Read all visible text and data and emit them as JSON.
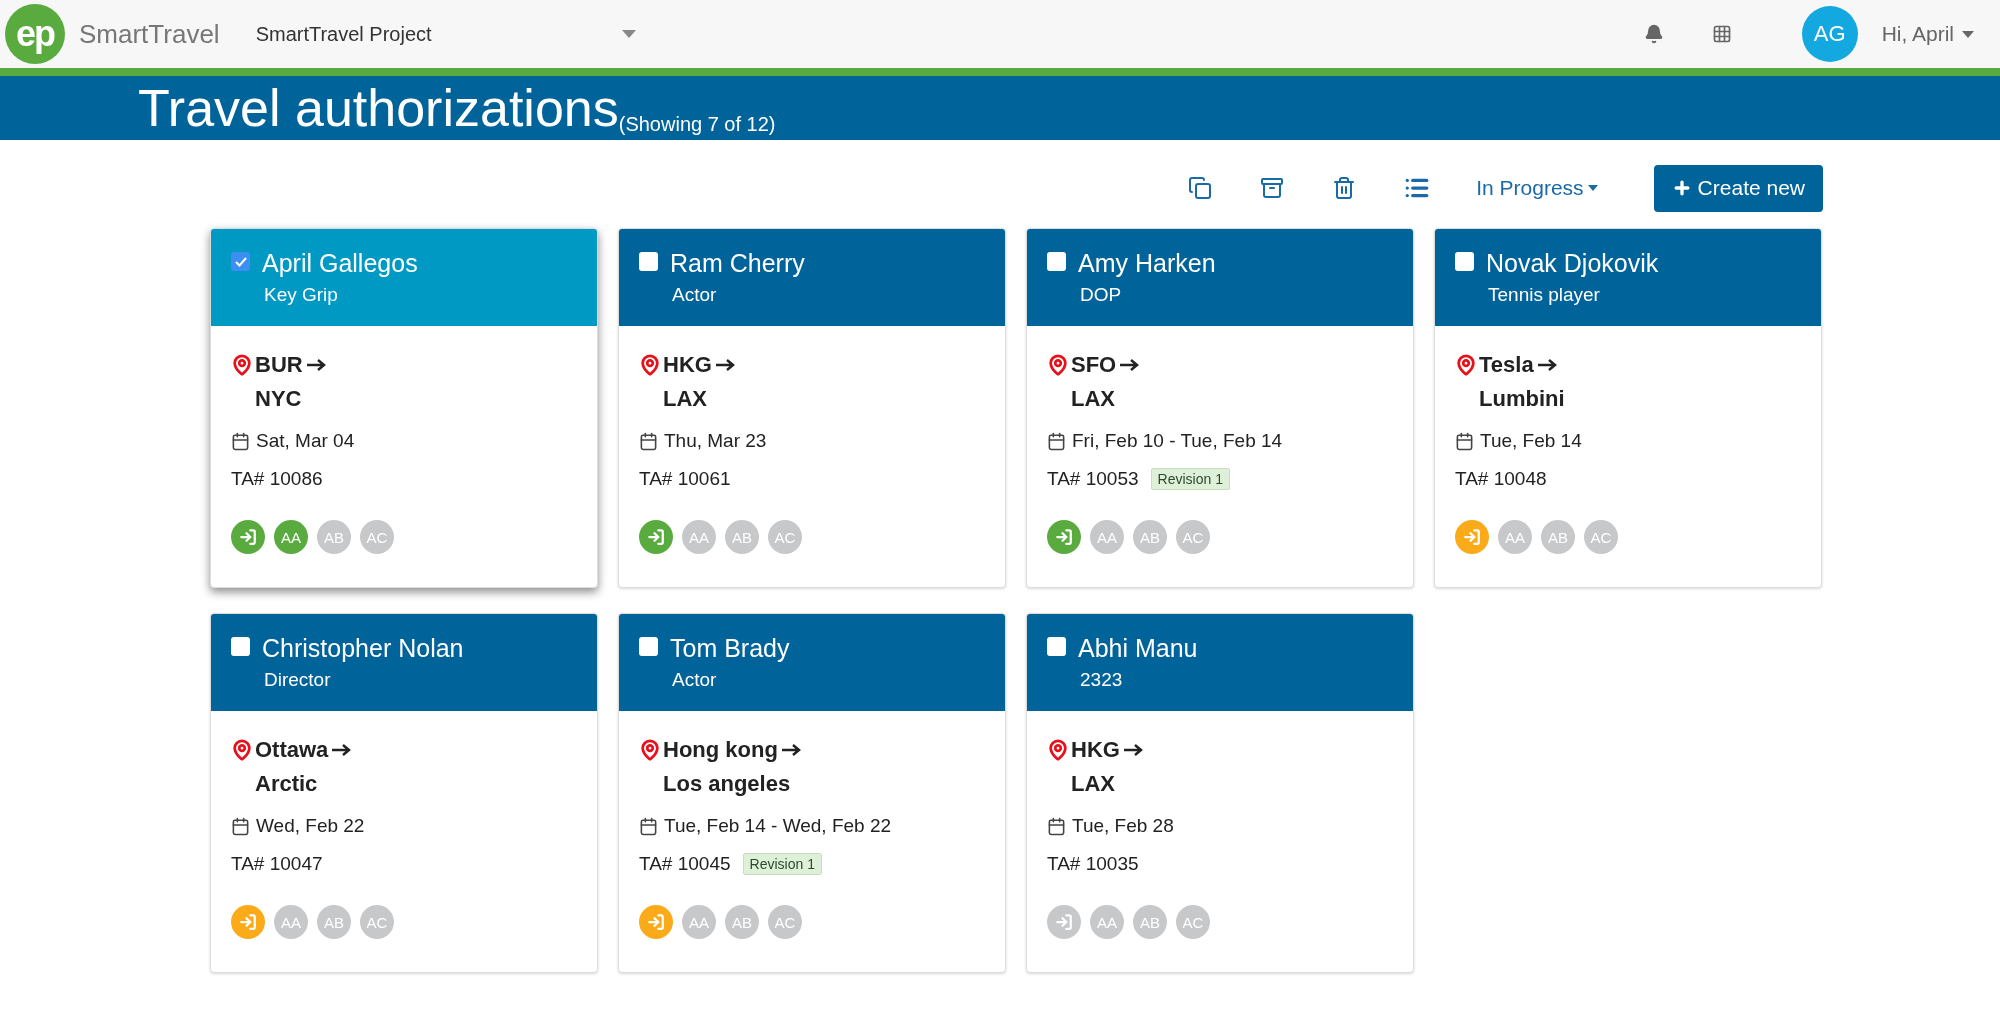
{
  "app": {
    "logo": "ep",
    "name": "SmartTravel",
    "project": "SmartTravel Project",
    "user_initials": "AG",
    "greeting": "Hi, April"
  },
  "page": {
    "title": "Travel authorizations",
    "count": "(Showing 7 of 12)"
  },
  "toolbar": {
    "filter": "In Progress",
    "create": "Create new"
  },
  "cards": [
    {
      "name": "April Gallegos",
      "role": "Key Grip",
      "selected": true,
      "from": "BUR",
      "to": "NYC",
      "dates": "Sat, Mar 04",
      "ta": "TA# 10086",
      "steps": [
        {
          "kind": "submit",
          "color": "#5aab3f"
        },
        {
          "kind": "approver",
          "label": "AA",
          "color": "#5aab3f"
        },
        {
          "kind": "approver",
          "label": "AB",
          "color": "#c6c8ca"
        },
        {
          "kind": "approver",
          "label": "AC",
          "color": "#c6c8ca"
        }
      ]
    },
    {
      "name": "Ram Cherry",
      "role": "Actor",
      "selected": false,
      "from": "HKG",
      "to": "LAX",
      "dates": "Thu, Mar 23",
      "ta": "TA# 10061",
      "steps": [
        {
          "kind": "submit",
          "color": "#5aab3f"
        },
        {
          "kind": "approver",
          "label": "AA",
          "color": "#c6c8ca"
        },
        {
          "kind": "approver",
          "label": "AB",
          "color": "#c6c8ca"
        },
        {
          "kind": "approver",
          "label": "AC",
          "color": "#c6c8ca"
        }
      ]
    },
    {
      "name": "Amy Harken",
      "role": "DOP",
      "selected": false,
      "from": "SFO",
      "to": "LAX",
      "dates": "Fri, Feb 10 - Tue, Feb 14",
      "ta": "TA# 10053",
      "badge": "Revision 1",
      "steps": [
        {
          "kind": "submit",
          "color": "#5aab3f"
        },
        {
          "kind": "approver",
          "label": "AA",
          "color": "#c6c8ca"
        },
        {
          "kind": "approver",
          "label": "AB",
          "color": "#c6c8ca"
        },
        {
          "kind": "approver",
          "label": "AC",
          "color": "#c6c8ca"
        }
      ]
    },
    {
      "name": "Novak Djokovik",
      "role": "Tennis player",
      "selected": false,
      "from": "Tesla",
      "to": "Lumbini",
      "dates": "Tue, Feb 14",
      "ta": "TA# 10048",
      "steps": [
        {
          "kind": "submit",
          "color": "#fbab19"
        },
        {
          "kind": "approver",
          "label": "AA",
          "color": "#c6c8ca"
        },
        {
          "kind": "approver",
          "label": "AB",
          "color": "#c6c8ca"
        },
        {
          "kind": "approver",
          "label": "AC",
          "color": "#c6c8ca"
        }
      ]
    },
    {
      "name": "Christopher Nolan",
      "role": "Director",
      "selected": false,
      "from": "Ottawa",
      "to": "Arctic",
      "dates": "Wed, Feb 22",
      "ta": "TA# 10047",
      "steps": [
        {
          "kind": "submit",
          "color": "#fbab19"
        },
        {
          "kind": "approver",
          "label": "AA",
          "color": "#c6c8ca"
        },
        {
          "kind": "approver",
          "label": "AB",
          "color": "#c6c8ca"
        },
        {
          "kind": "approver",
          "label": "AC",
          "color": "#c6c8ca"
        }
      ]
    },
    {
      "name": "Tom Brady",
      "role": "Actor",
      "selected": false,
      "from": "Hong kong",
      "to": "Los angeles",
      "dates": "Tue, Feb 14 - Wed, Feb 22",
      "ta": "TA# 10045",
      "badge": "Revision 1",
      "steps": [
        {
          "kind": "submit",
          "color": "#fbab19"
        },
        {
          "kind": "approver",
          "label": "AA",
          "color": "#c6c8ca"
        },
        {
          "kind": "approver",
          "label": "AB",
          "color": "#c6c8ca"
        },
        {
          "kind": "approver",
          "label": "AC",
          "color": "#c6c8ca"
        }
      ]
    },
    {
      "name": "Abhi Manu",
      "role": "2323",
      "selected": false,
      "from": "HKG",
      "to": "LAX",
      "dates": "Tue, Feb 28",
      "ta": "TA# 10035",
      "steps": [
        {
          "kind": "submit",
          "color": "#c6c8ca"
        },
        {
          "kind": "approver",
          "label": "AA",
          "color": "#c6c8ca"
        },
        {
          "kind": "approver",
          "label": "AB",
          "color": "#c6c8ca"
        },
        {
          "kind": "approver",
          "label": "AC",
          "color": "#c6c8ca"
        }
      ]
    }
  ]
}
